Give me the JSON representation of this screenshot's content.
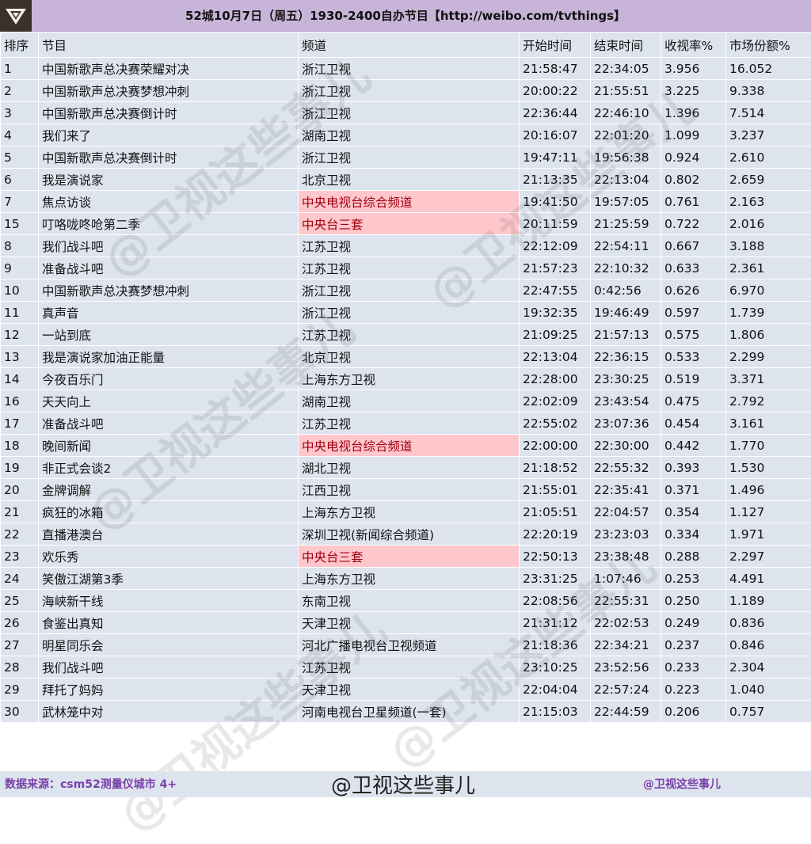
{
  "header": {
    "title": "52城10月7日（周五）1930-2400自办节目【http://weibo.com/tvthings】"
  },
  "columns": [
    "排序",
    "节目",
    "频道",
    "开始时间",
    "结束时间",
    "收视率%",
    "市场份额%"
  ],
  "rows": [
    {
      "rank": "1",
      "program": "中国新歌声总决赛荣耀对决",
      "channel": "浙江卫视",
      "start": "21:58:47",
      "end": "22:34:05",
      "rating": "3.956",
      "share": "16.052",
      "highlight": false
    },
    {
      "rank": "2",
      "program": "中国新歌声总决赛梦想冲刺",
      "channel": "浙江卫视",
      "start": "20:00:22",
      "end": "21:55:51",
      "rating": "3.225",
      "share": "9.338",
      "highlight": false
    },
    {
      "rank": "3",
      "program": "中国新歌声总决赛倒计时",
      "channel": "浙江卫视",
      "start": "22:36:44",
      "end": "22:46:10",
      "rating": "1.396",
      "share": "7.514",
      "highlight": false
    },
    {
      "rank": "4",
      "program": "我们来了",
      "channel": "湖南卫视",
      "start": "20:16:07",
      "end": "22:01:20",
      "rating": "1.099",
      "share": "3.237",
      "highlight": false
    },
    {
      "rank": "5",
      "program": "中国新歌声总决赛倒计时",
      "channel": "浙江卫视",
      "start": "19:47:11",
      "end": "19:56:38",
      "rating": "0.924",
      "share": "2.610",
      "highlight": false
    },
    {
      "rank": "6",
      "program": "我是演说家",
      "channel": "北京卫视",
      "start": "21:13:35",
      "end": "22:13:04",
      "rating": "0.802",
      "share": "2.659",
      "highlight": false
    },
    {
      "rank": "7",
      "program": "焦点访谈",
      "channel": "中央电视台综合频道",
      "start": "19:41:50",
      "end": "19:57:05",
      "rating": "0.761",
      "share": "2.163",
      "highlight": true
    },
    {
      "rank": "15",
      "program": "叮咯咙咚呛第二季",
      "channel": "中央台三套",
      "start": "20:11:59",
      "end": "21:25:59",
      "rating": "0.722",
      "share": "2.016",
      "highlight": true
    },
    {
      "rank": "8",
      "program": "我们战斗吧",
      "channel": "江苏卫视",
      "start": "22:12:09",
      "end": "22:54:11",
      "rating": "0.667",
      "share": "3.188",
      "highlight": false
    },
    {
      "rank": "9",
      "program": "准备战斗吧",
      "channel": "江苏卫视",
      "start": "21:57:23",
      "end": "22:10:32",
      "rating": "0.633",
      "share": "2.361",
      "highlight": false
    },
    {
      "rank": "10",
      "program": "中国新歌声总决赛梦想冲刺",
      "channel": "浙江卫视",
      "start": "22:47:55",
      "end": "0:42:56",
      "rating": "0.626",
      "share": "6.970",
      "highlight": false
    },
    {
      "rank": "11",
      "program": "真声音",
      "channel": "浙江卫视",
      "start": "19:32:35",
      "end": "19:46:49",
      "rating": "0.597",
      "share": "1.739",
      "highlight": false
    },
    {
      "rank": "12",
      "program": "一站到底",
      "channel": "江苏卫视",
      "start": "21:09:25",
      "end": "21:57:13",
      "rating": "0.575",
      "share": "1.806",
      "highlight": false
    },
    {
      "rank": "13",
      "program": "我是演说家加油正能量",
      "channel": "北京卫视",
      "start": "22:13:04",
      "end": "22:36:15",
      "rating": "0.533",
      "share": "2.299",
      "highlight": false
    },
    {
      "rank": "14",
      "program": "今夜百乐门",
      "channel": "上海东方卫视",
      "start": "22:28:00",
      "end": "23:30:25",
      "rating": "0.519",
      "share": "3.371",
      "highlight": false
    },
    {
      "rank": "16",
      "program": "天天向上",
      "channel": "湖南卫视",
      "start": "22:02:09",
      "end": "23:43:54",
      "rating": "0.475",
      "share": "2.792",
      "highlight": false
    },
    {
      "rank": "17",
      "program": "准备战斗吧",
      "channel": "江苏卫视",
      "start": "22:55:02",
      "end": "23:07:36",
      "rating": "0.454",
      "share": "3.161",
      "highlight": false
    },
    {
      "rank": "18",
      "program": "晚间新闻",
      "channel": "中央电视台综合频道",
      "start": "22:00:00",
      "end": "22:30:00",
      "rating": "0.442",
      "share": "1.770",
      "highlight": true
    },
    {
      "rank": "19",
      "program": "非正式会谈2",
      "channel": "湖北卫视",
      "start": "21:18:52",
      "end": "22:55:32",
      "rating": "0.393",
      "share": "1.530",
      "highlight": false
    },
    {
      "rank": "20",
      "program": "金牌调解",
      "channel": "江西卫视",
      "start": "21:55:01",
      "end": "22:35:41",
      "rating": "0.371",
      "share": "1.496",
      "highlight": false
    },
    {
      "rank": "21",
      "program": "疯狂的冰箱",
      "channel": "上海东方卫视",
      "start": "21:05:51",
      "end": "22:04:57",
      "rating": "0.354",
      "share": "1.127",
      "highlight": false
    },
    {
      "rank": "22",
      "program": "直播港澳台",
      "channel": "深圳卫视(新闻综合频道)",
      "start": "22:20:19",
      "end": "23:23:03",
      "rating": "0.334",
      "share": "1.971",
      "highlight": false
    },
    {
      "rank": "23",
      "program": "欢乐秀",
      "channel": "中央台三套",
      "start": "22:50:13",
      "end": "23:38:48",
      "rating": "0.288",
      "share": "2.297",
      "highlight": true
    },
    {
      "rank": "24",
      "program": "笑傲江湖第3季",
      "channel": "上海东方卫视",
      "start": "23:31:25",
      "end": "1:07:46",
      "rating": "0.253",
      "share": "4.491",
      "highlight": false
    },
    {
      "rank": "25",
      "program": "海峡新干线",
      "channel": "东南卫视",
      "start": "22:08:56",
      "end": "22:55:31",
      "rating": "0.250",
      "share": "1.189",
      "highlight": false
    },
    {
      "rank": "26",
      "program": "食鉴出真知",
      "channel": "天津卫视",
      "start": "21:31:12",
      "end": "22:02:53",
      "rating": "0.249",
      "share": "0.836",
      "highlight": false
    },
    {
      "rank": "27",
      "program": "明星同乐会",
      "channel": "河北广播电视台卫视频道",
      "start": "21:18:36",
      "end": "22:34:21",
      "rating": "0.237",
      "share": "0.846",
      "highlight": false
    },
    {
      "rank": "28",
      "program": "我们战斗吧",
      "channel": "江苏卫视",
      "start": "23:10:25",
      "end": "23:52:56",
      "rating": "0.233",
      "share": "2.304",
      "highlight": false
    },
    {
      "rank": "29",
      "program": "拜托了妈妈",
      "channel": "天津卫视",
      "start": "22:04:04",
      "end": "22:57:24",
      "rating": "0.223",
      "share": "1.040",
      "highlight": false
    },
    {
      "rank": "30",
      "program": "武林笼中对",
      "channel": "河南电视台卫星频道(一套)",
      "start": "21:15:03",
      "end": "22:44:59",
      "rating": "0.206",
      "share": "0.757",
      "highlight": false
    }
  ],
  "footer": {
    "source": "数据来源：csm52测量仪城市 4+",
    "watermark_center": "@卫视这些事儿",
    "credit": "@卫视这些事儿"
  },
  "watermark": "@卫视这些事儿",
  "colors": {
    "header_bg": "#c8b4d8",
    "row_bg": "#dde4ee",
    "highlight_bg": "#ffc7cc",
    "highlight_text": "#a00010",
    "footer_text": "#7a3fa8"
  },
  "icons": [
    "logo-icon"
  ]
}
